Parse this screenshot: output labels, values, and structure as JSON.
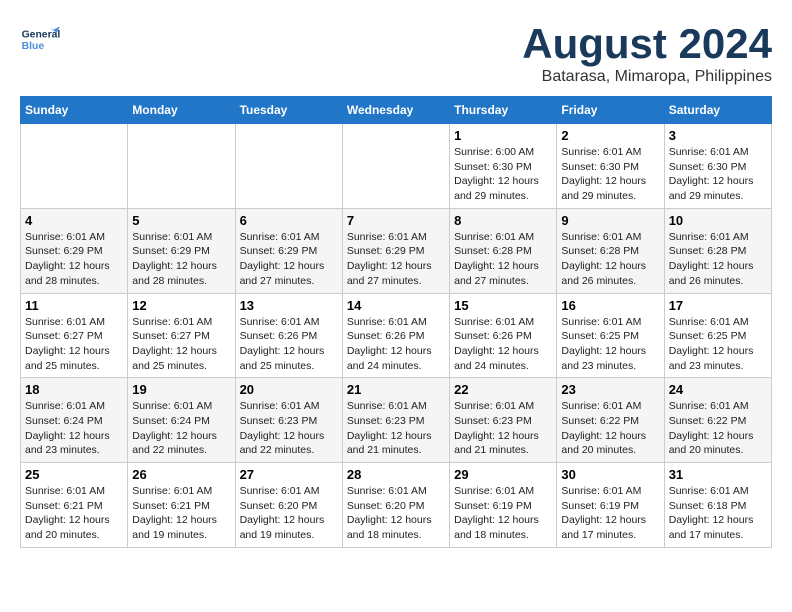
{
  "header": {
    "logo_general": "General",
    "logo_blue": "Blue",
    "month_title": "August 2024",
    "location": "Batarasa, Mimaropa, Philippines"
  },
  "calendar": {
    "days_of_week": [
      "Sunday",
      "Monday",
      "Tuesday",
      "Wednesday",
      "Thursday",
      "Friday",
      "Saturday"
    ],
    "weeks": [
      [
        {
          "day": "",
          "info": ""
        },
        {
          "day": "",
          "info": ""
        },
        {
          "day": "",
          "info": ""
        },
        {
          "day": "",
          "info": ""
        },
        {
          "day": "1",
          "info": "Sunrise: 6:00 AM\nSunset: 6:30 PM\nDaylight: 12 hours\nand 29 minutes."
        },
        {
          "day": "2",
          "info": "Sunrise: 6:01 AM\nSunset: 6:30 PM\nDaylight: 12 hours\nand 29 minutes."
        },
        {
          "day": "3",
          "info": "Sunrise: 6:01 AM\nSunset: 6:30 PM\nDaylight: 12 hours\nand 29 minutes."
        }
      ],
      [
        {
          "day": "4",
          "info": "Sunrise: 6:01 AM\nSunset: 6:29 PM\nDaylight: 12 hours\nand 28 minutes."
        },
        {
          "day": "5",
          "info": "Sunrise: 6:01 AM\nSunset: 6:29 PM\nDaylight: 12 hours\nand 28 minutes."
        },
        {
          "day": "6",
          "info": "Sunrise: 6:01 AM\nSunset: 6:29 PM\nDaylight: 12 hours\nand 27 minutes."
        },
        {
          "day": "7",
          "info": "Sunrise: 6:01 AM\nSunset: 6:29 PM\nDaylight: 12 hours\nand 27 minutes."
        },
        {
          "day": "8",
          "info": "Sunrise: 6:01 AM\nSunset: 6:28 PM\nDaylight: 12 hours\nand 27 minutes."
        },
        {
          "day": "9",
          "info": "Sunrise: 6:01 AM\nSunset: 6:28 PM\nDaylight: 12 hours\nand 26 minutes."
        },
        {
          "day": "10",
          "info": "Sunrise: 6:01 AM\nSunset: 6:28 PM\nDaylight: 12 hours\nand 26 minutes."
        }
      ],
      [
        {
          "day": "11",
          "info": "Sunrise: 6:01 AM\nSunset: 6:27 PM\nDaylight: 12 hours\nand 25 minutes."
        },
        {
          "day": "12",
          "info": "Sunrise: 6:01 AM\nSunset: 6:27 PM\nDaylight: 12 hours\nand 25 minutes."
        },
        {
          "day": "13",
          "info": "Sunrise: 6:01 AM\nSunset: 6:26 PM\nDaylight: 12 hours\nand 25 minutes."
        },
        {
          "day": "14",
          "info": "Sunrise: 6:01 AM\nSunset: 6:26 PM\nDaylight: 12 hours\nand 24 minutes."
        },
        {
          "day": "15",
          "info": "Sunrise: 6:01 AM\nSunset: 6:26 PM\nDaylight: 12 hours\nand 24 minutes."
        },
        {
          "day": "16",
          "info": "Sunrise: 6:01 AM\nSunset: 6:25 PM\nDaylight: 12 hours\nand 23 minutes."
        },
        {
          "day": "17",
          "info": "Sunrise: 6:01 AM\nSunset: 6:25 PM\nDaylight: 12 hours\nand 23 minutes."
        }
      ],
      [
        {
          "day": "18",
          "info": "Sunrise: 6:01 AM\nSunset: 6:24 PM\nDaylight: 12 hours\nand 23 minutes."
        },
        {
          "day": "19",
          "info": "Sunrise: 6:01 AM\nSunset: 6:24 PM\nDaylight: 12 hours\nand 22 minutes."
        },
        {
          "day": "20",
          "info": "Sunrise: 6:01 AM\nSunset: 6:23 PM\nDaylight: 12 hours\nand 22 minutes."
        },
        {
          "day": "21",
          "info": "Sunrise: 6:01 AM\nSunset: 6:23 PM\nDaylight: 12 hours\nand 21 minutes."
        },
        {
          "day": "22",
          "info": "Sunrise: 6:01 AM\nSunset: 6:23 PM\nDaylight: 12 hours\nand 21 minutes."
        },
        {
          "day": "23",
          "info": "Sunrise: 6:01 AM\nSunset: 6:22 PM\nDaylight: 12 hours\nand 20 minutes."
        },
        {
          "day": "24",
          "info": "Sunrise: 6:01 AM\nSunset: 6:22 PM\nDaylight: 12 hours\nand 20 minutes."
        }
      ],
      [
        {
          "day": "25",
          "info": "Sunrise: 6:01 AM\nSunset: 6:21 PM\nDaylight: 12 hours\nand 20 minutes."
        },
        {
          "day": "26",
          "info": "Sunrise: 6:01 AM\nSunset: 6:21 PM\nDaylight: 12 hours\nand 19 minutes."
        },
        {
          "day": "27",
          "info": "Sunrise: 6:01 AM\nSunset: 6:20 PM\nDaylight: 12 hours\nand 19 minutes."
        },
        {
          "day": "28",
          "info": "Sunrise: 6:01 AM\nSunset: 6:20 PM\nDaylight: 12 hours\nand 18 minutes."
        },
        {
          "day": "29",
          "info": "Sunrise: 6:01 AM\nSunset: 6:19 PM\nDaylight: 12 hours\nand 18 minutes."
        },
        {
          "day": "30",
          "info": "Sunrise: 6:01 AM\nSunset: 6:19 PM\nDaylight: 12 hours\nand 17 minutes."
        },
        {
          "day": "31",
          "info": "Sunrise: 6:01 AM\nSunset: 6:18 PM\nDaylight: 12 hours\nand 17 minutes."
        }
      ]
    ]
  }
}
